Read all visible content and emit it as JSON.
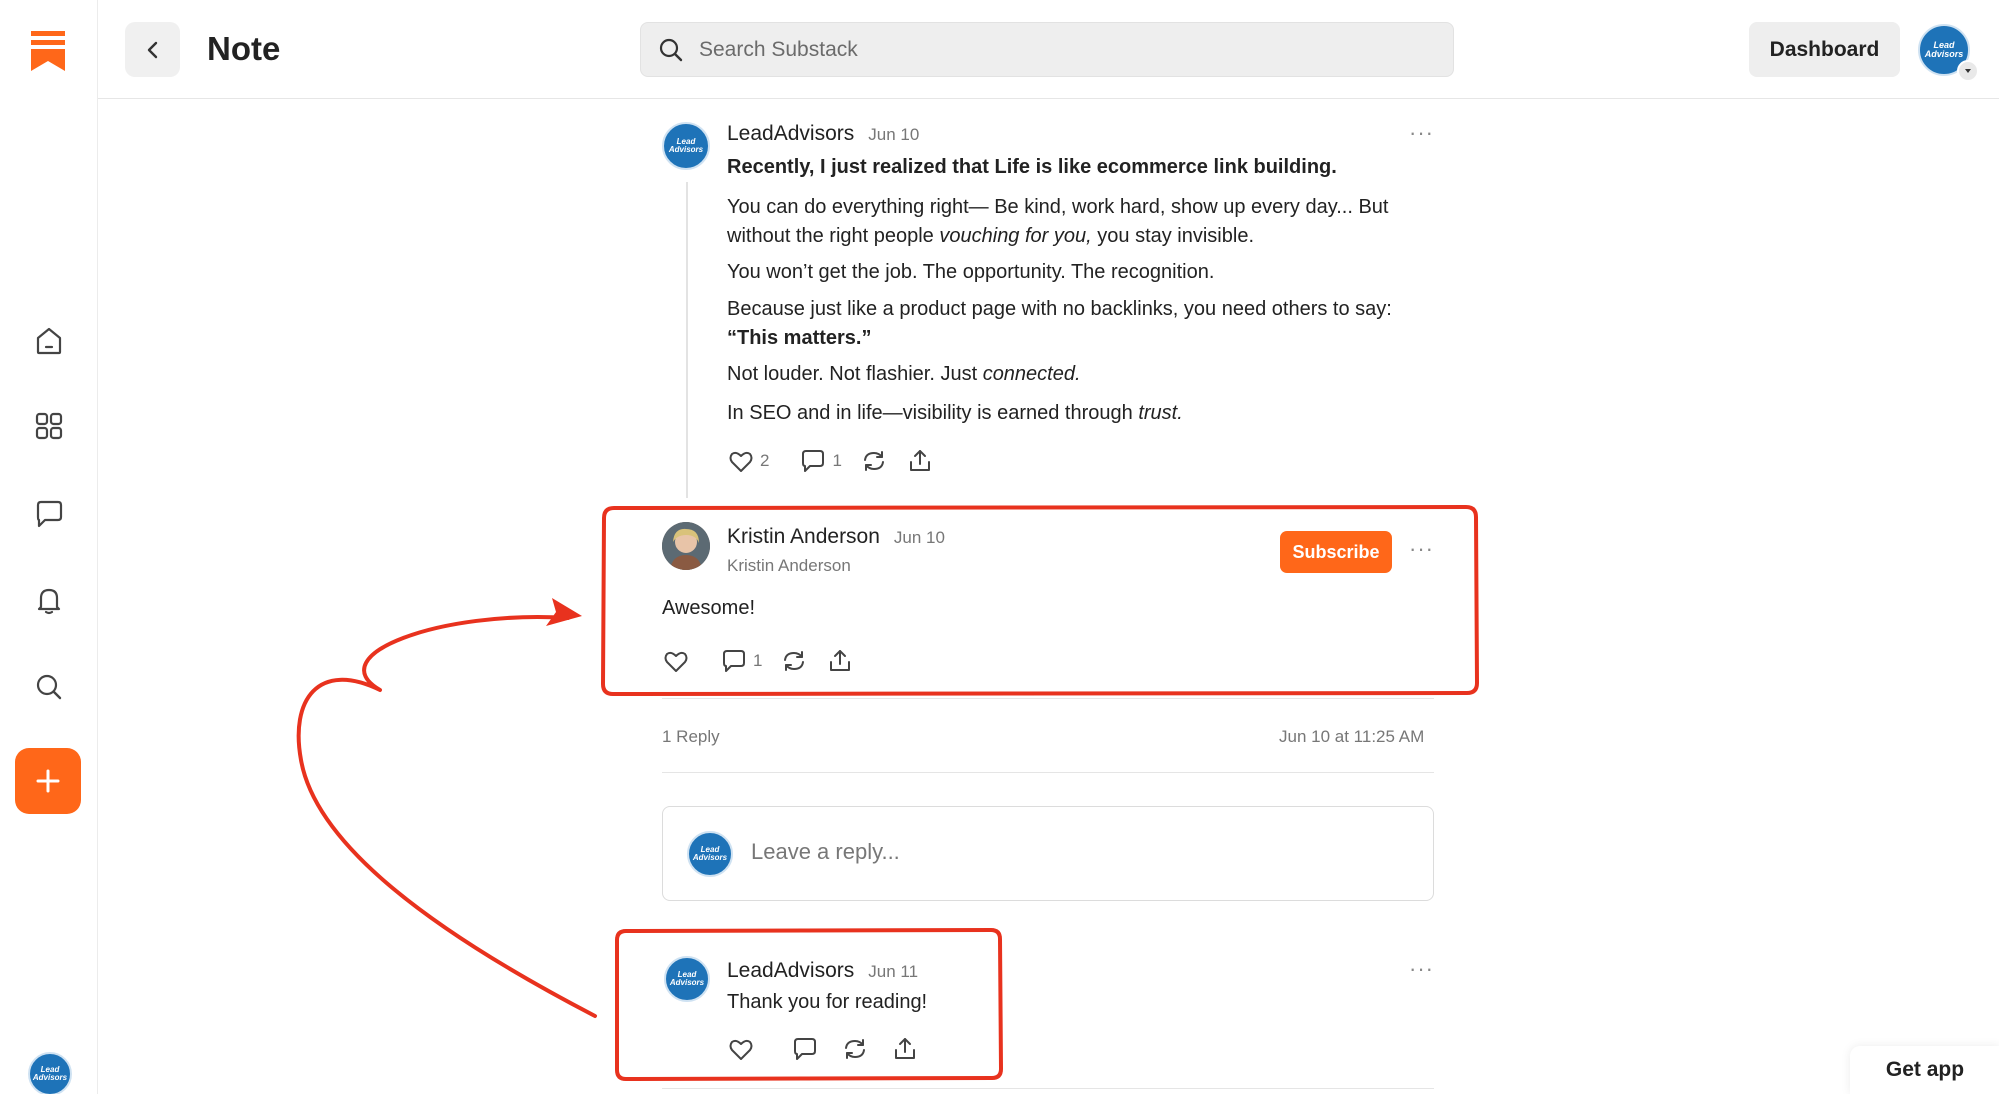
{
  "header": {
    "title": "Note",
    "search_placeholder": "Search Substack",
    "dashboard_label": "Dashboard"
  },
  "avatar_text": {
    "line1": "Lead",
    "line2": "Advisors"
  },
  "note": {
    "author": "LeadAdvisors",
    "date": "Jun 10",
    "headline": "Recently, I just realized that Life is like ecommerce link building.",
    "p1a": "You can do everything right— Be kind, work hard, show up every day... But without the right people ",
    "p1b": "vouching for you,",
    "p1c": " you stay invisible.",
    "p2": "You won’t get the job. The opportunity. The recognition.",
    "p3a": "Because just like a product page with no backlinks, you need others to say:",
    "p3b": "“This matters.”",
    "p4a": "Not louder. Not flashier. Just ",
    "p4b": "connected.",
    "p5a": "In SEO and in life—visibility is earned through ",
    "p5b": "trust.",
    "likes": "2",
    "comments": "1"
  },
  "comment": {
    "author": "Kristin Anderson",
    "date": "Jun 10",
    "subtitle": "Kristin Anderson",
    "subscribe_label": "Subscribe",
    "text": "Awesome!",
    "comments": "1"
  },
  "thread_meta": {
    "replies": "1 Reply",
    "timestamp": "Jun 10 at 11:25 AM"
  },
  "reply_box": {
    "placeholder": "Leave a reply..."
  },
  "reply": {
    "author": "LeadAdvisors",
    "date": "Jun 11",
    "text": "Thank you for reading!"
  },
  "more_glyph": "···",
  "get_app_label": "Get app",
  "colors": {
    "accent": "#ff6719",
    "annotation_red": "#e8321e",
    "avatar_blue": "#1e73b8"
  }
}
